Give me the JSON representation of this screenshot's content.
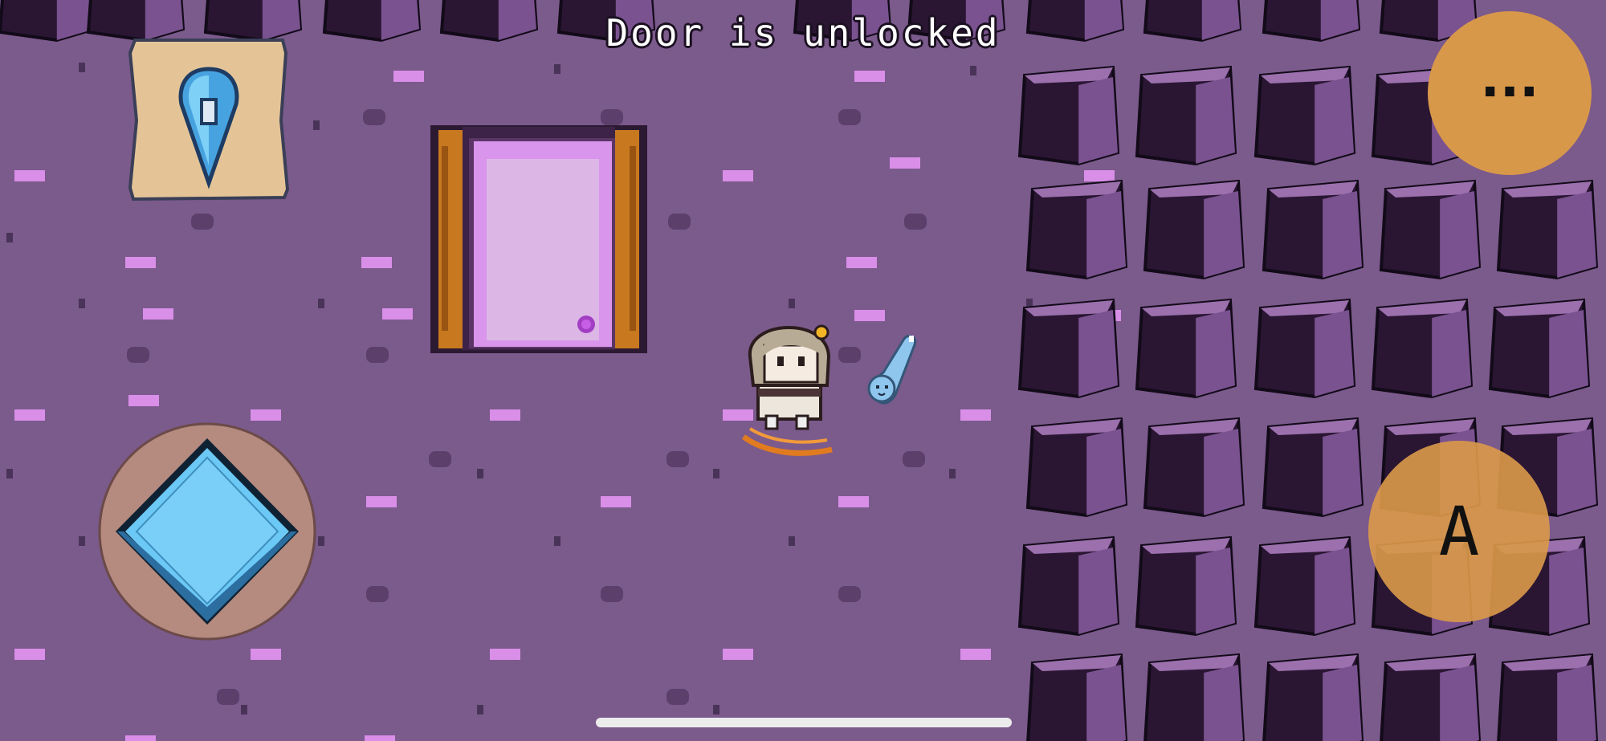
{
  "hud": {
    "message": "Door is unlocked",
    "menu_button_label": "...",
    "action_button_label": "A"
  },
  "map_icon": "map-pin-icon",
  "dpad_icon": "diamond-dpad-icon",
  "colors": {
    "floor": "#7b5a8c",
    "brick_highlight": "#d98ee8",
    "brick_shadow": "#5c3f6a",
    "rock_dark": "#2a1633",
    "rock_light": "#9b70ad",
    "door_frame": "#c8781e",
    "door_inner": "#d8b2e4",
    "button_orange": "#d8984a",
    "dpad_blue": "#6cc8f5"
  }
}
